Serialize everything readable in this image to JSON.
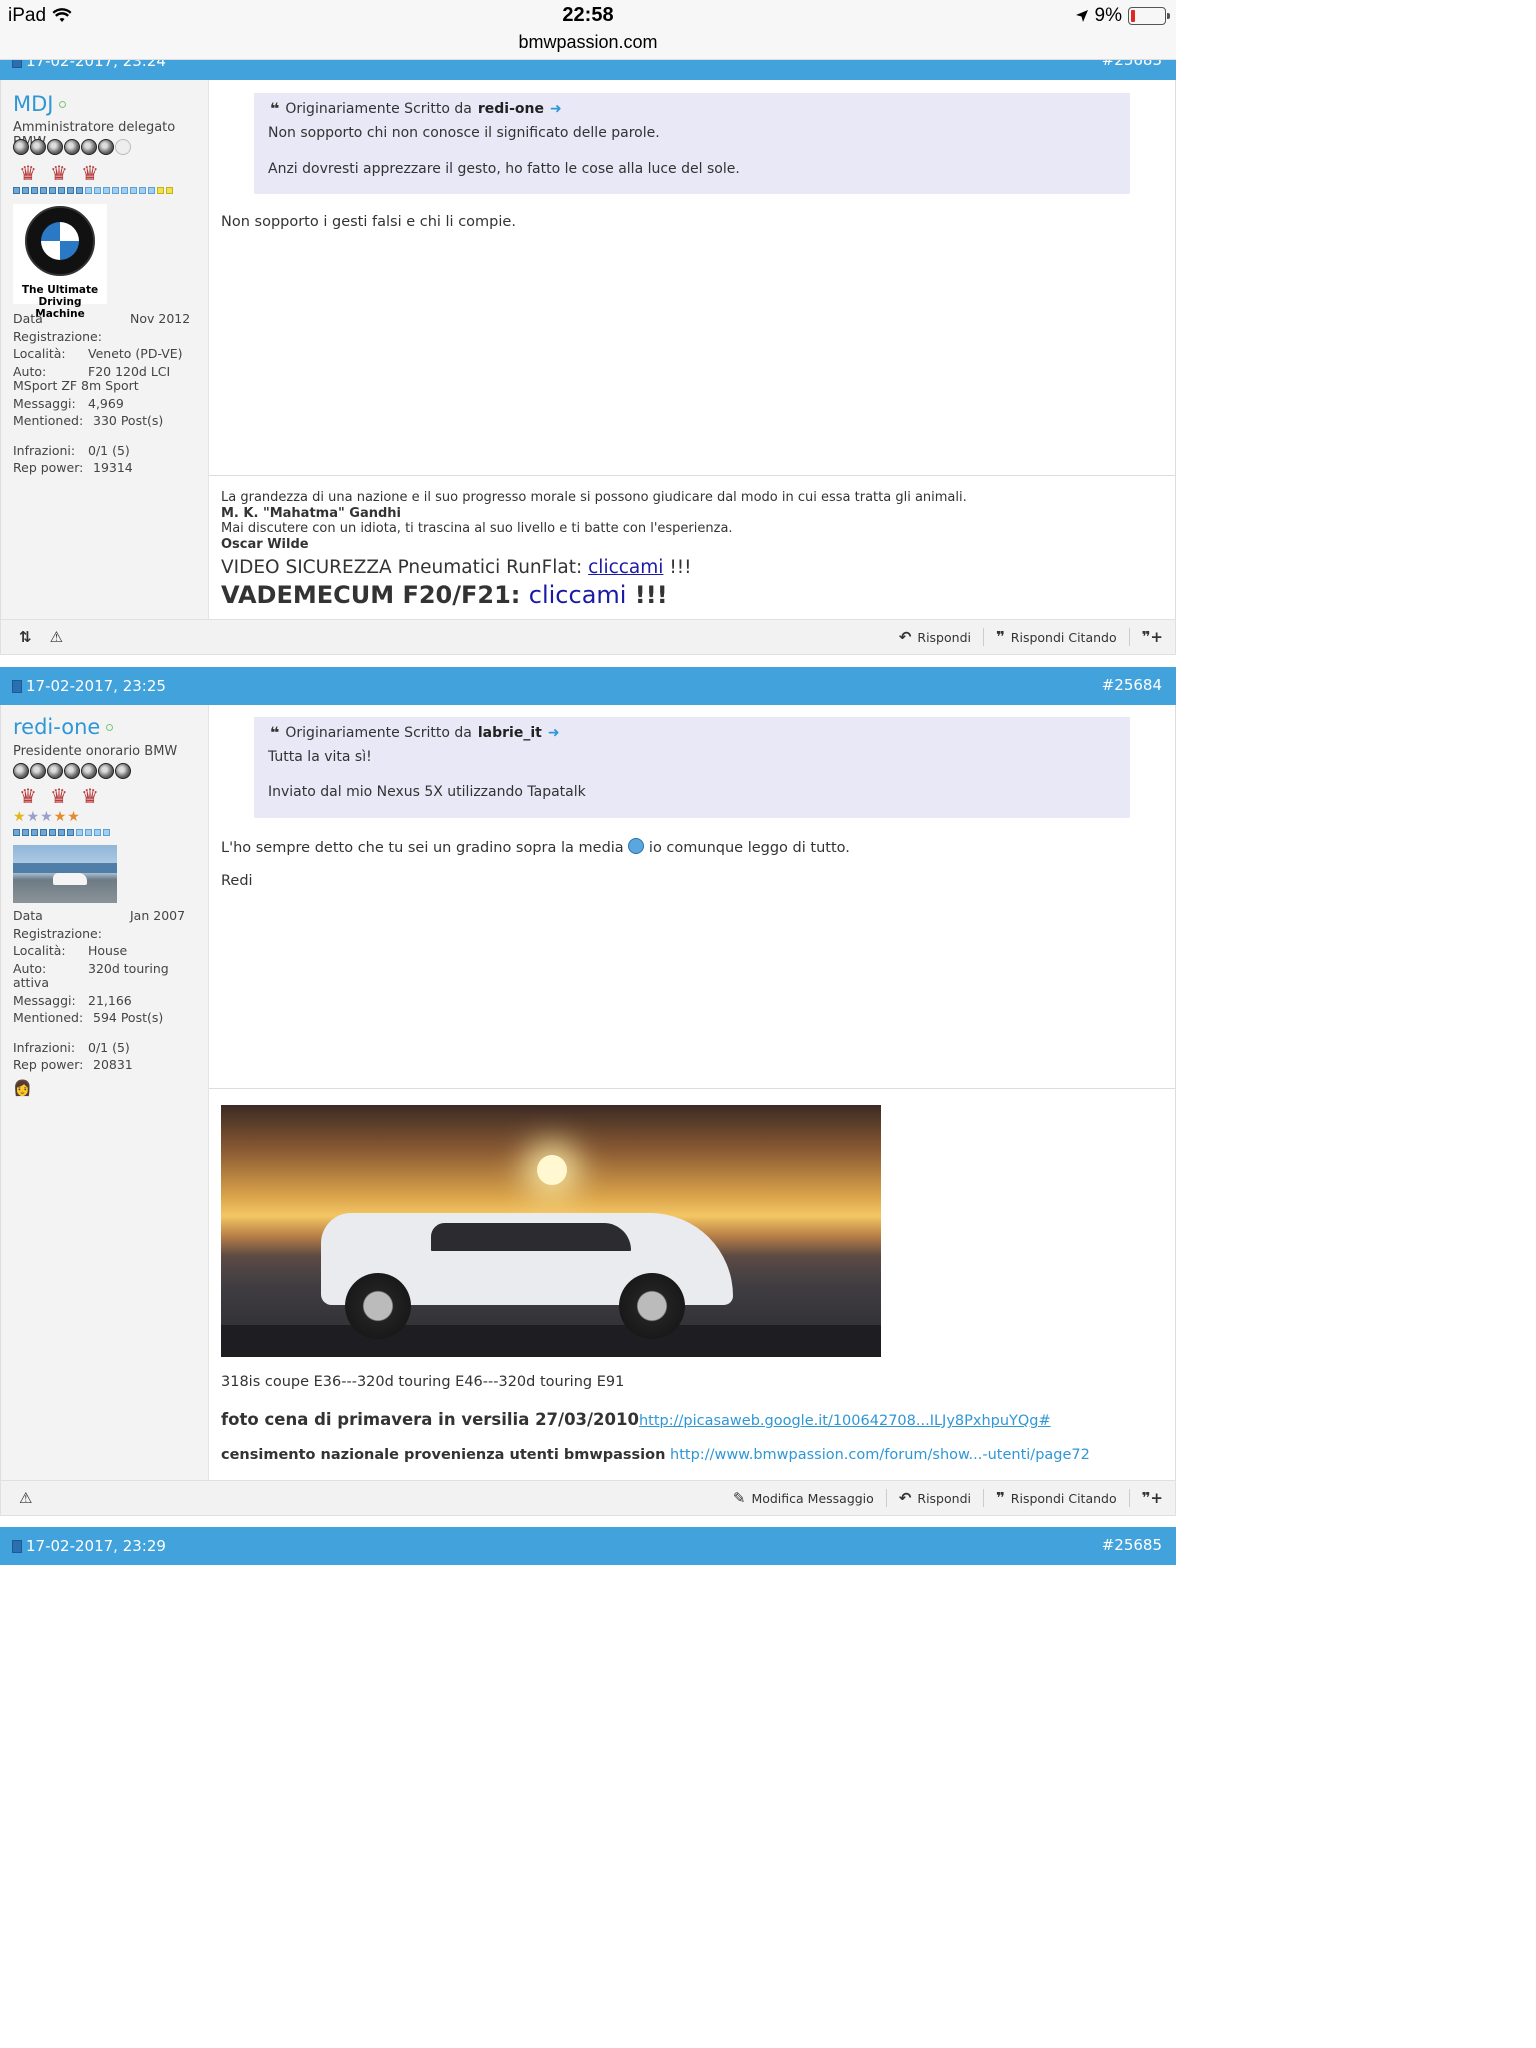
{
  "status_bar": {
    "device": "iPad",
    "time": "22:58",
    "url": "bmwpassion.com",
    "battery": "9%"
  },
  "posts": [
    {
      "date": "17-02-2017, 23:24",
      "number": "#25683",
      "user": {
        "name": "MDJ",
        "title": "Amministratore delegato BMW",
        "avatar_caption_line1": "The Ultimate",
        "avatar_caption_line2": "Driving Machine",
        "stats": {
          "registration_label": "Data Registrazione:",
          "registration": "Nov 2012",
          "location_label": "Località:",
          "location": "Veneto (PD-VE)",
          "auto_label": "Auto:",
          "auto": "F20 120d LCI",
          "auto_cont": "MSport ZF 8m Sport",
          "messages_label": "Messaggi:",
          "messages": "4,969",
          "mentioned_label": "Mentioned:",
          "mentioned": "330 Post(s)",
          "infractions_label": "Infrazioni:",
          "infractions": "0/1 (5)",
          "rep_label": "Rep power:",
          "rep": "19314"
        }
      },
      "quote": {
        "prefix": "Originariamente Scritto da",
        "author": "redi-one",
        "line1": "Non sopporto chi non conosce il significato delle parole.",
        "line2": "Anzi dovresti apprezzare il gesto, ho fatto le cose alla luce del sole."
      },
      "text": "Non sopporto i gesti falsi e chi li compie.",
      "signature": {
        "line1": "La grandezza di una nazione e il suo progresso morale si possono giudicare dal modo in cui essa tratta gli animali.",
        "line1_author": "M. K. \"Mahatma\" Gandhi",
        "line2": "Mai discutere con un idiota, ti trascina al suo livello e ti batte con l'esperienza.",
        "line2_author": "Oscar Wilde",
        "video_prefix": "VIDEO SICUREZZA Pneumatici RunFlat: ",
        "video_link": "cliccami",
        "video_suffix": " !!!",
        "vademecum_prefix": "VADEMECUM F20/F21: ",
        "vademecum_link": "cliccami",
        "vademecum_suffix": " !!!"
      },
      "actions": {
        "reply": "Rispondi",
        "reply_quote": "Rispondi Citando"
      }
    },
    {
      "date": "17-02-2017, 23:25",
      "number": "#25684",
      "user": {
        "name": "redi-one",
        "title": "Presidente onorario BMW",
        "stats": {
          "registration_label": "Data Registrazione:",
          "registration": "Jan 2007",
          "location_label": "Località:",
          "location": "House",
          "auto_label": "Auto:",
          "auto": "320d touring",
          "auto_cont": "attiva",
          "messages_label": "Messaggi:",
          "messages": "21,166",
          "mentioned_label": "Mentioned:",
          "mentioned": "594 Post(s)",
          "infractions_label": "Infrazioni:",
          "infractions": "0/1 (5)",
          "rep_label": "Rep power:",
          "rep": "20831"
        }
      },
      "quote": {
        "prefix": "Originariamente Scritto da",
        "author": "labrie_it",
        "line1": "Tutta la vita sì!",
        "line2": "Inviato dal mio Nexus 5X utilizzando Tapatalk"
      },
      "text_before": "L'ho sempre detto che tu sei un gradino sopra la media",
      "text_after": "io comunque leggo di tutto.",
      "text2": "Redi",
      "signature": {
        "cars": "318is coupe E36---320d touring E46---320d touring E91",
        "photo_label": "foto cena di primavera in versilia 27/03/2010",
        "photo_link": "http://picasaweb.google.it/100642708...ILJy8PxhpuYQg#",
        "census_label": "censimento nazionale provenienza utenti bmwpassion",
        "census_link": "http://www.bmwpassion.com/forum/show...-utenti/page72"
      },
      "actions": {
        "edit": "Modifica Messaggio",
        "reply": "Rispondi",
        "reply_quote": "Rispondi Citando"
      }
    },
    {
      "date": "17-02-2017, 23:29",
      "number": "#25685"
    }
  ]
}
